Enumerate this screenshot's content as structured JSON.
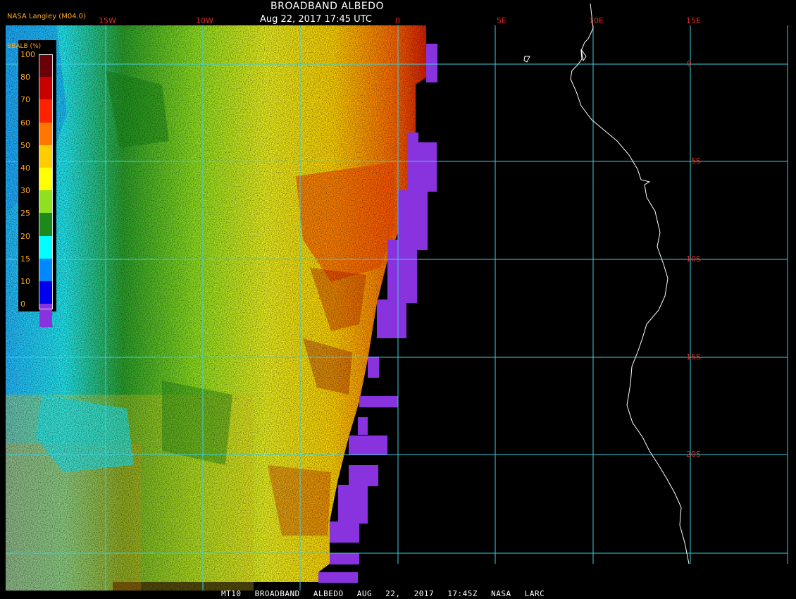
{
  "header": {
    "title": "BROADBAND ALBEDO",
    "datetime": "Aug 22, 2017 17:45 UTC",
    "org": "NASA Langley (M04.0)"
  },
  "footer": "MT10  BROADBAND ALBEDO  AUG 22, 2017 17:45Z  NASA LARC",
  "legend": {
    "title": "BBALB (%)",
    "ticks": [
      "100",
      "80",
      "70",
      "60",
      "50",
      "40",
      "30",
      "25",
      "20",
      "15",
      "10",
      "0"
    ],
    "colors": [
      "#6b0008",
      "#c80000",
      "#ff2200",
      "#ff7700",
      "#ffcc00",
      "#ffff00",
      "#8ee020",
      "#1a8a1a",
      "#00ffff",
      "#0088ff",
      "#0000ee",
      "#8833dd"
    ]
  },
  "grid": {
    "lon_labels": [
      "15W",
      "10W",
      "0",
      "5E",
      "10E",
      "15E"
    ],
    "lat_labels": [
      "0",
      "5S",
      "10S",
      "15S",
      "20S"
    ],
    "line_color": "#3ccfdf",
    "label_color": "#e0302a"
  },
  "colors": {
    "background": "#000000",
    "coast": "#ffffff",
    "nodata_edge": "#8833dd"
  }
}
